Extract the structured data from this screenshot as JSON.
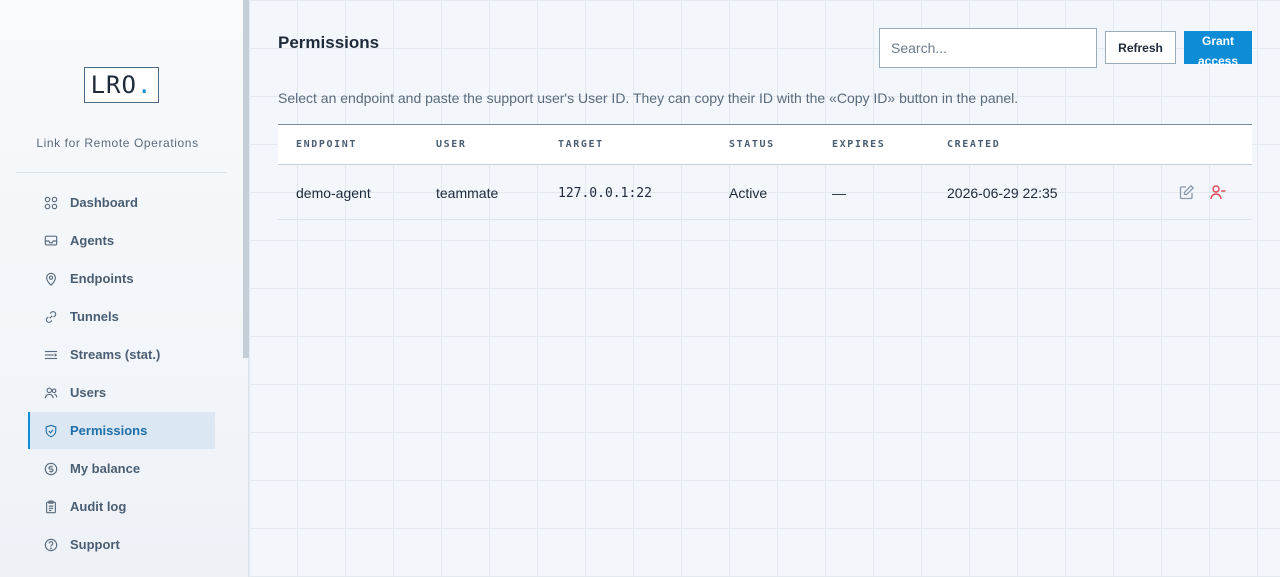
{
  "app": {
    "logo_text": "LRO",
    "logo_dot": ".",
    "tagline": "Link for Remote Operations"
  },
  "sidebar": {
    "items": [
      {
        "label": "Dashboard",
        "icon": "grid-icon"
      },
      {
        "label": "Agents",
        "icon": "inbox-icon"
      },
      {
        "label": "Endpoints",
        "icon": "location-pin-icon"
      },
      {
        "label": "Tunnels",
        "icon": "link-icon"
      },
      {
        "label": "Streams (stat.)",
        "icon": "streams-icon"
      },
      {
        "label": "Users",
        "icon": "users-icon"
      },
      {
        "label": "Permissions",
        "icon": "shield-check-icon",
        "active": true
      },
      {
        "label": "My balance",
        "icon": "dollar-circle-icon"
      },
      {
        "label": "Audit log",
        "icon": "clipboard-icon"
      },
      {
        "label": "Support",
        "icon": "help-circle-icon"
      }
    ]
  },
  "page": {
    "title": "Permissions",
    "description": "Select an endpoint and paste the support user's User ID. They can copy their ID with the «Copy ID» button in the panel.",
    "search_placeholder": "Search...",
    "refresh_label": "Refresh",
    "grant_label": "Grant access"
  },
  "table": {
    "columns": [
      "ENDPOINT",
      "USER",
      "TARGET",
      "STATUS",
      "EXPIRES",
      "CREATED"
    ],
    "rows": [
      {
        "endpoint": "demo-agent",
        "user": "teammate",
        "target": "127.0.0.1:22",
        "status": "Active",
        "expires": "—",
        "created": "2026-06-29 22:35"
      }
    ]
  },
  "colors": {
    "accent": "#0e8dd6",
    "danger": "#e0455a",
    "active_nav_bg": "#dbe7f2"
  }
}
